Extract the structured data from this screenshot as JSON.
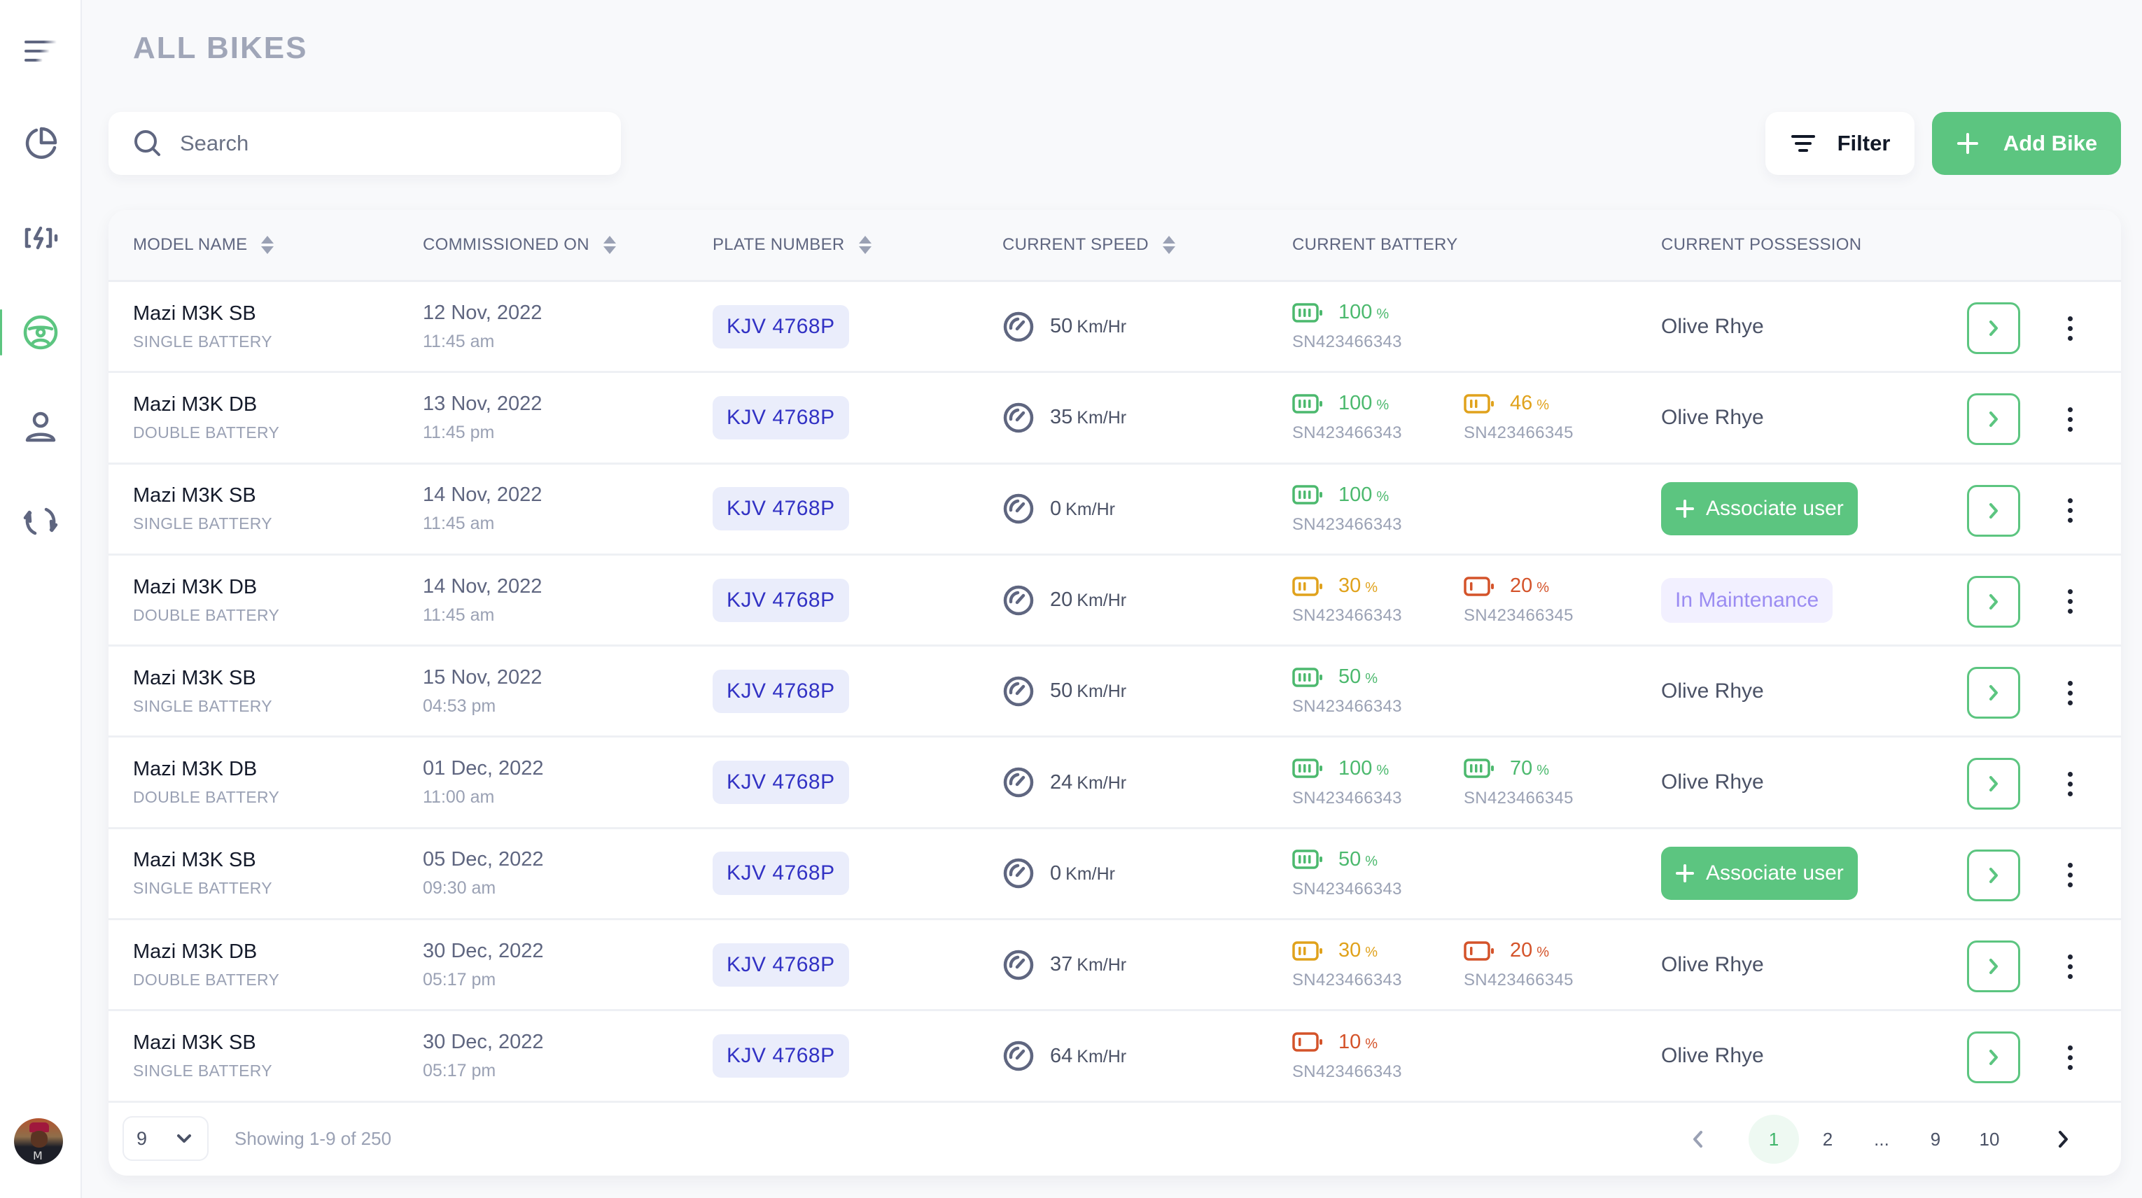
{
  "sidebar": {
    "items": [
      {
        "name": "menu",
        "icon": "menu-lines-icon",
        "active": false
      },
      {
        "name": "dashboard",
        "icon": "pie-chart-icon",
        "active": false
      },
      {
        "name": "batteries",
        "icon": "battery-charging-icon",
        "active": false
      },
      {
        "name": "bikes",
        "icon": "steering-wheel-icon",
        "active": true
      },
      {
        "name": "users",
        "icon": "user-icon",
        "active": false
      },
      {
        "name": "swaps",
        "icon": "refresh-icon",
        "active": false
      }
    ],
    "avatar_initial": "M"
  },
  "header": {
    "title": "ALL BIKES",
    "search_placeholder": "Search",
    "filter_label": "Filter",
    "add_label": "Add Bike"
  },
  "colors": {
    "accent": "#5cc580",
    "battery_high": "#4cb96e",
    "battery_mid": "#e0a21c",
    "battery_low": "#d4532a",
    "plate_text": "#3232c4",
    "plate_bg": "#eaedfb",
    "maintenance_text": "#9b8cf2",
    "maintenance_bg": "#f2f0ff"
  },
  "table": {
    "columns": [
      {
        "label": "MODEL NAME",
        "sortable": true
      },
      {
        "label": "COMMISSIONED ON",
        "sortable": true
      },
      {
        "label": "PLATE NUMBER",
        "sortable": true
      },
      {
        "label": "CURRENT SPEED",
        "sortable": true
      },
      {
        "label": "CURRENT BATTERY",
        "sortable": false
      },
      {
        "label": "CURRENT POSSESSION",
        "sortable": false
      }
    ],
    "speed_unit": "Km/Hr",
    "percent_sign": "%",
    "associate_label": "Associate user",
    "rows": [
      {
        "model": "Mazi M3K SB",
        "type": "SINGLE BATTERY",
        "date": "12 Nov, 2022",
        "time": "11:45 am",
        "plate": "KJV 4768P",
        "speed": "50",
        "batteries": [
          {
            "pct": "100",
            "level": "high",
            "sn": "SN423466343"
          }
        ],
        "possession": {
          "kind": "user",
          "text": "Olive Rhye"
        }
      },
      {
        "model": "Mazi M3K DB",
        "type": "DOUBLE BATTERY",
        "date": "13 Nov, 2022",
        "time": "11:45 pm",
        "plate": "KJV 4768P",
        "speed": "35",
        "batteries": [
          {
            "pct": "100",
            "level": "high",
            "sn": "SN423466343"
          },
          {
            "pct": "46",
            "level": "mid",
            "sn": "SN423466345"
          }
        ],
        "possession": {
          "kind": "user",
          "text": "Olive Rhye"
        }
      },
      {
        "model": "Mazi M3K SB",
        "type": "SINGLE BATTERY",
        "date": "14 Nov, 2022",
        "time": "11:45 am",
        "plate": "KJV 4768P",
        "speed": "0",
        "batteries": [
          {
            "pct": "100",
            "level": "high",
            "sn": "SN423466343"
          }
        ],
        "possession": {
          "kind": "associate",
          "text": "Associate user"
        }
      },
      {
        "model": "Mazi M3K DB",
        "type": "DOUBLE BATTERY",
        "date": "14 Nov, 2022",
        "time": "11:45 am",
        "plate": "KJV 4768P",
        "speed": "20",
        "batteries": [
          {
            "pct": "30",
            "level": "mid",
            "sn": "SN423466343"
          },
          {
            "pct": "20",
            "level": "low",
            "sn": "SN423466345"
          }
        ],
        "possession": {
          "kind": "maintenance",
          "text": "In Maintenance"
        }
      },
      {
        "model": "Mazi M3K SB",
        "type": "SINGLE BATTERY",
        "date": "15 Nov, 2022",
        "time": "04:53 pm",
        "plate": "KJV 4768P",
        "speed": "50",
        "batteries": [
          {
            "pct": "50",
            "level": "high",
            "sn": "SN423466343"
          }
        ],
        "possession": {
          "kind": "user",
          "text": "Olive Rhye"
        }
      },
      {
        "model": "Mazi M3K DB",
        "type": "DOUBLE BATTERY",
        "date": "01 Dec, 2022",
        "time": "11:00 am",
        "plate": "KJV 4768P",
        "speed": "24",
        "batteries": [
          {
            "pct": "100",
            "level": "high",
            "sn": "SN423466343"
          },
          {
            "pct": "70",
            "level": "high",
            "sn": "SN423466345"
          }
        ],
        "possession": {
          "kind": "user",
          "text": "Olive Rhye"
        }
      },
      {
        "model": "Mazi M3K SB",
        "type": "SINGLE BATTERY",
        "date": "05 Dec, 2022",
        "time": "09:30 am",
        "plate": "KJV 4768P",
        "speed": "0",
        "batteries": [
          {
            "pct": "50",
            "level": "high",
            "sn": "SN423466343"
          }
        ],
        "possession": {
          "kind": "associate",
          "text": "Associate user"
        }
      },
      {
        "model": "Mazi M3K DB",
        "type": "DOUBLE BATTERY",
        "date": "30 Dec, 2022",
        "time": "05:17 pm",
        "plate": "KJV 4768P",
        "speed": "37",
        "batteries": [
          {
            "pct": "30",
            "level": "mid",
            "sn": "SN423466343"
          },
          {
            "pct": "20",
            "level": "low",
            "sn": "SN423466345"
          }
        ],
        "possession": {
          "kind": "user",
          "text": "Olive Rhye"
        }
      },
      {
        "model": "Mazi M3K SB",
        "type": "SINGLE BATTERY",
        "date": "30 Dec, 2022",
        "time": "05:17 pm",
        "plate": "KJV 4768P",
        "speed": "64",
        "batteries": [
          {
            "pct": "10",
            "level": "low",
            "sn": "SN423466343"
          }
        ],
        "possession": {
          "kind": "user",
          "text": "Olive Rhye"
        }
      }
    ]
  },
  "footer": {
    "page_size": "9",
    "showing": "Showing 1-9 of 250",
    "pages": [
      "1",
      "2",
      "...",
      "9",
      "10"
    ],
    "current_page": "1"
  }
}
